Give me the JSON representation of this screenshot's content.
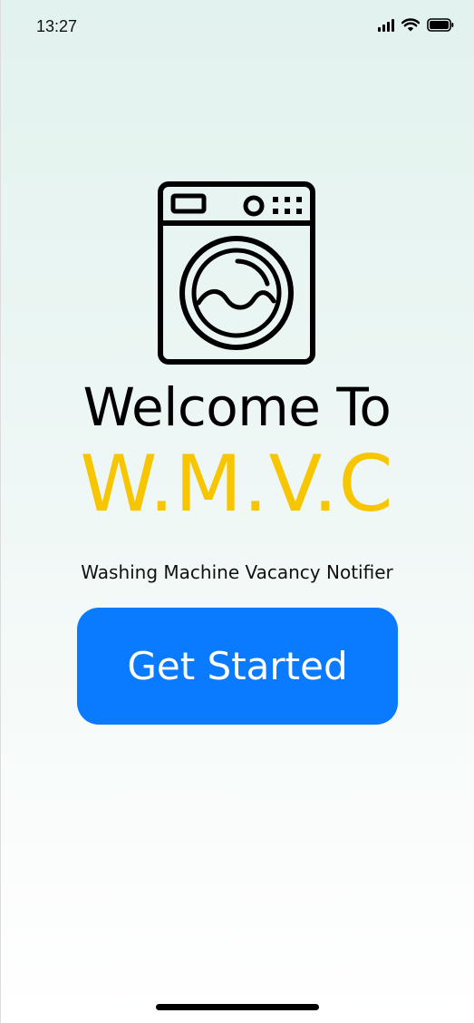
{
  "status_bar": {
    "time": "13:27",
    "icons": [
      "cellular-signal-icon",
      "wifi-icon",
      "battery-icon"
    ]
  },
  "hero": {
    "icon": "washing-machine-icon",
    "welcome_text": "Welcome To",
    "brand_text": "W.M.V.C",
    "subtitle": "Washing Machine Vacancy Notifier"
  },
  "actions": {
    "get_started_label": "Get Started"
  },
  "colors": {
    "brand": "#f7c600",
    "button": "#0a7aff",
    "button_text": "#ffffff",
    "background_top": "#e2f2ee",
    "background_bottom": "#ffffff"
  }
}
